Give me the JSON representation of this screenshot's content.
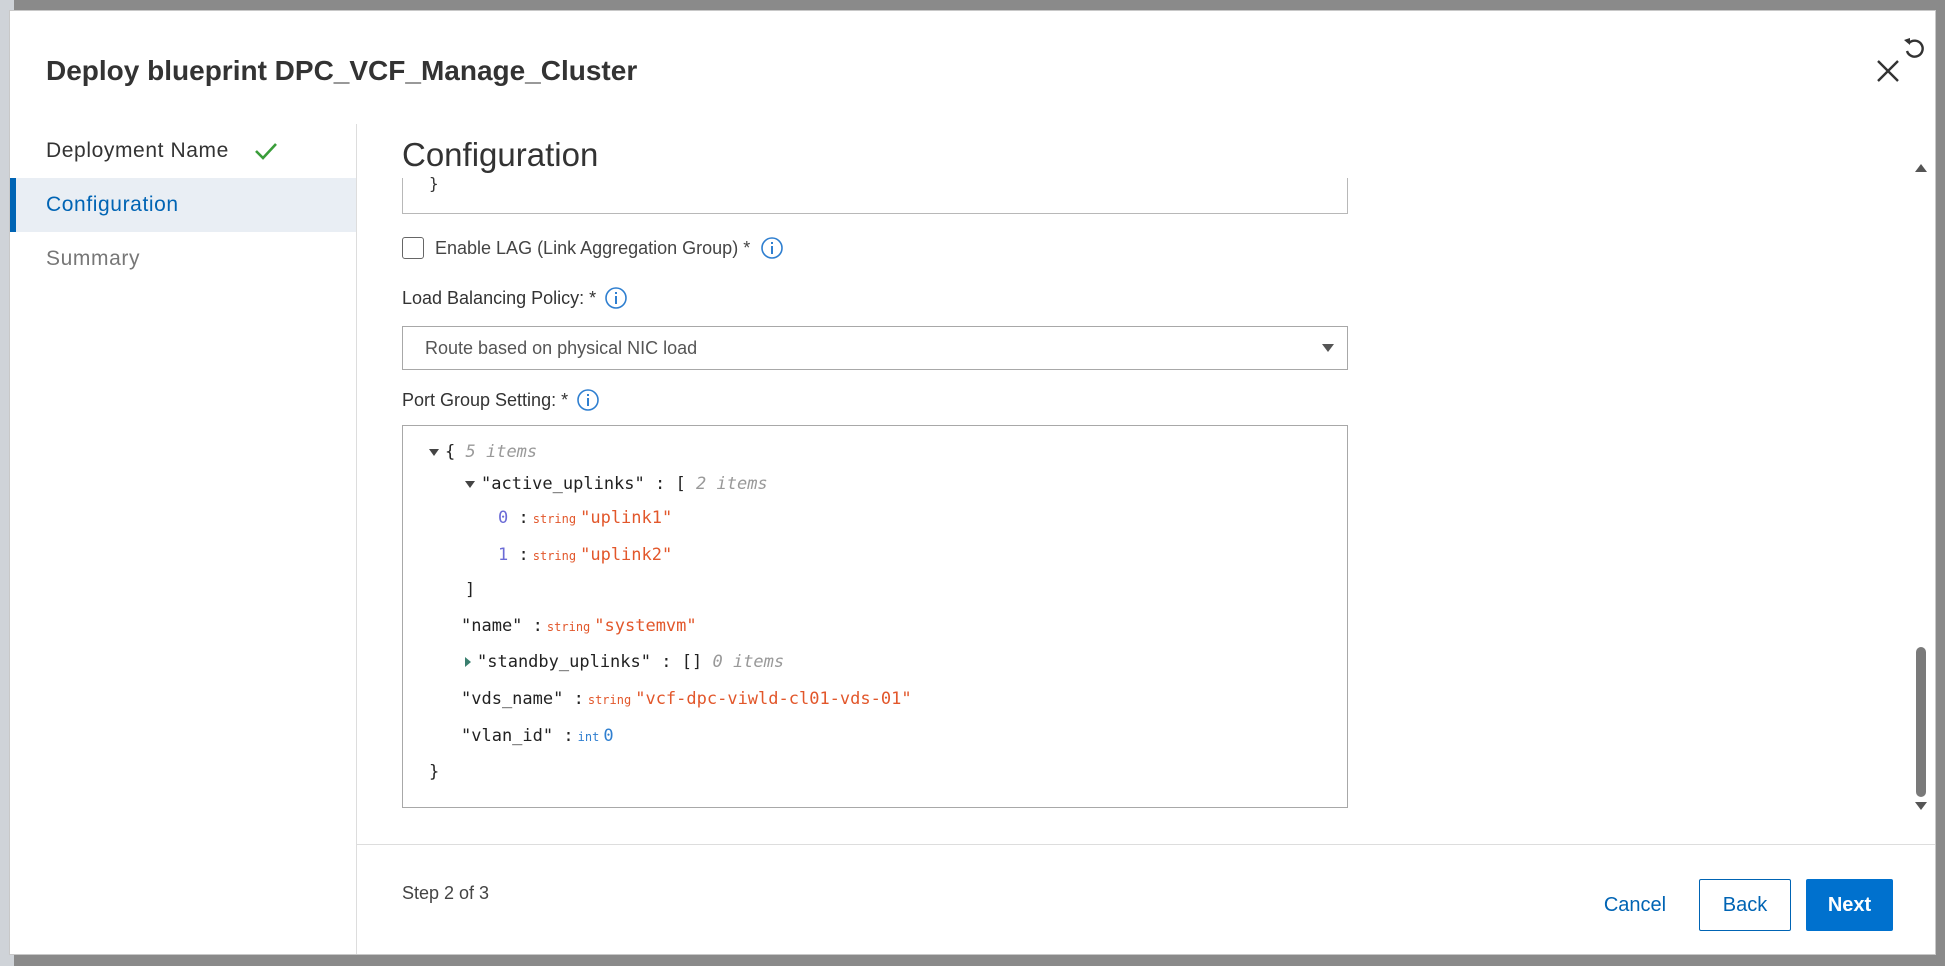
{
  "dialog": {
    "title": "Deploy blueprint DPC_VCF_Manage_Cluster"
  },
  "sidebar": {
    "steps": [
      {
        "label": "Deployment Name",
        "state": "completed"
      },
      {
        "label": "Configuration",
        "state": "active"
      },
      {
        "label": "Summary",
        "state": "disabled"
      }
    ]
  },
  "main": {
    "section_title": "Configuration",
    "top_box_fragment": "}",
    "lag": {
      "label": "Enable LAG (Link Aggregation Group) *",
      "checked": false
    },
    "load_balancing": {
      "label": "Load Balancing Policy: *",
      "selected": "Route based on physical NIC load"
    },
    "port_group": {
      "label": "Port Group Setting: *",
      "json": {
        "root_open": "{",
        "root_count": "5 items",
        "active_uplinks_key": "\"active_uplinks\"",
        "active_uplinks_open": "[",
        "active_uplinks_count": "2 items",
        "items": [
          {
            "index": "0",
            "type": "string",
            "value": "\"uplink1\""
          },
          {
            "index": "1",
            "type": "string",
            "value": "\"uplink2\""
          }
        ],
        "active_uplinks_close": "]",
        "name_key": "\"name\"",
        "name_type": "string",
        "name_value": "\"systemvm\"",
        "standby_key": "\"standby_uplinks\"",
        "standby_value": "[]",
        "standby_count": "0 items",
        "vds_key": "\"vds_name\"",
        "vds_type": "string",
        "vds_value": "\"vcf-dpc-viwld-cl01-vds-01\"",
        "vlan_key": "\"vlan_id\"",
        "vlan_type": "int",
        "vlan_value": "0",
        "root_close": "}",
        "colon": ":"
      }
    }
  },
  "footer": {
    "step_text": "Step 2 of 3",
    "cancel_label": "Cancel",
    "back_label": "Back",
    "next_label": "Next"
  },
  "colors": {
    "accent": "#0064b4",
    "success": "#3a9d3a",
    "string_value": "#e2572b",
    "number_value": "#2f7fd0"
  }
}
